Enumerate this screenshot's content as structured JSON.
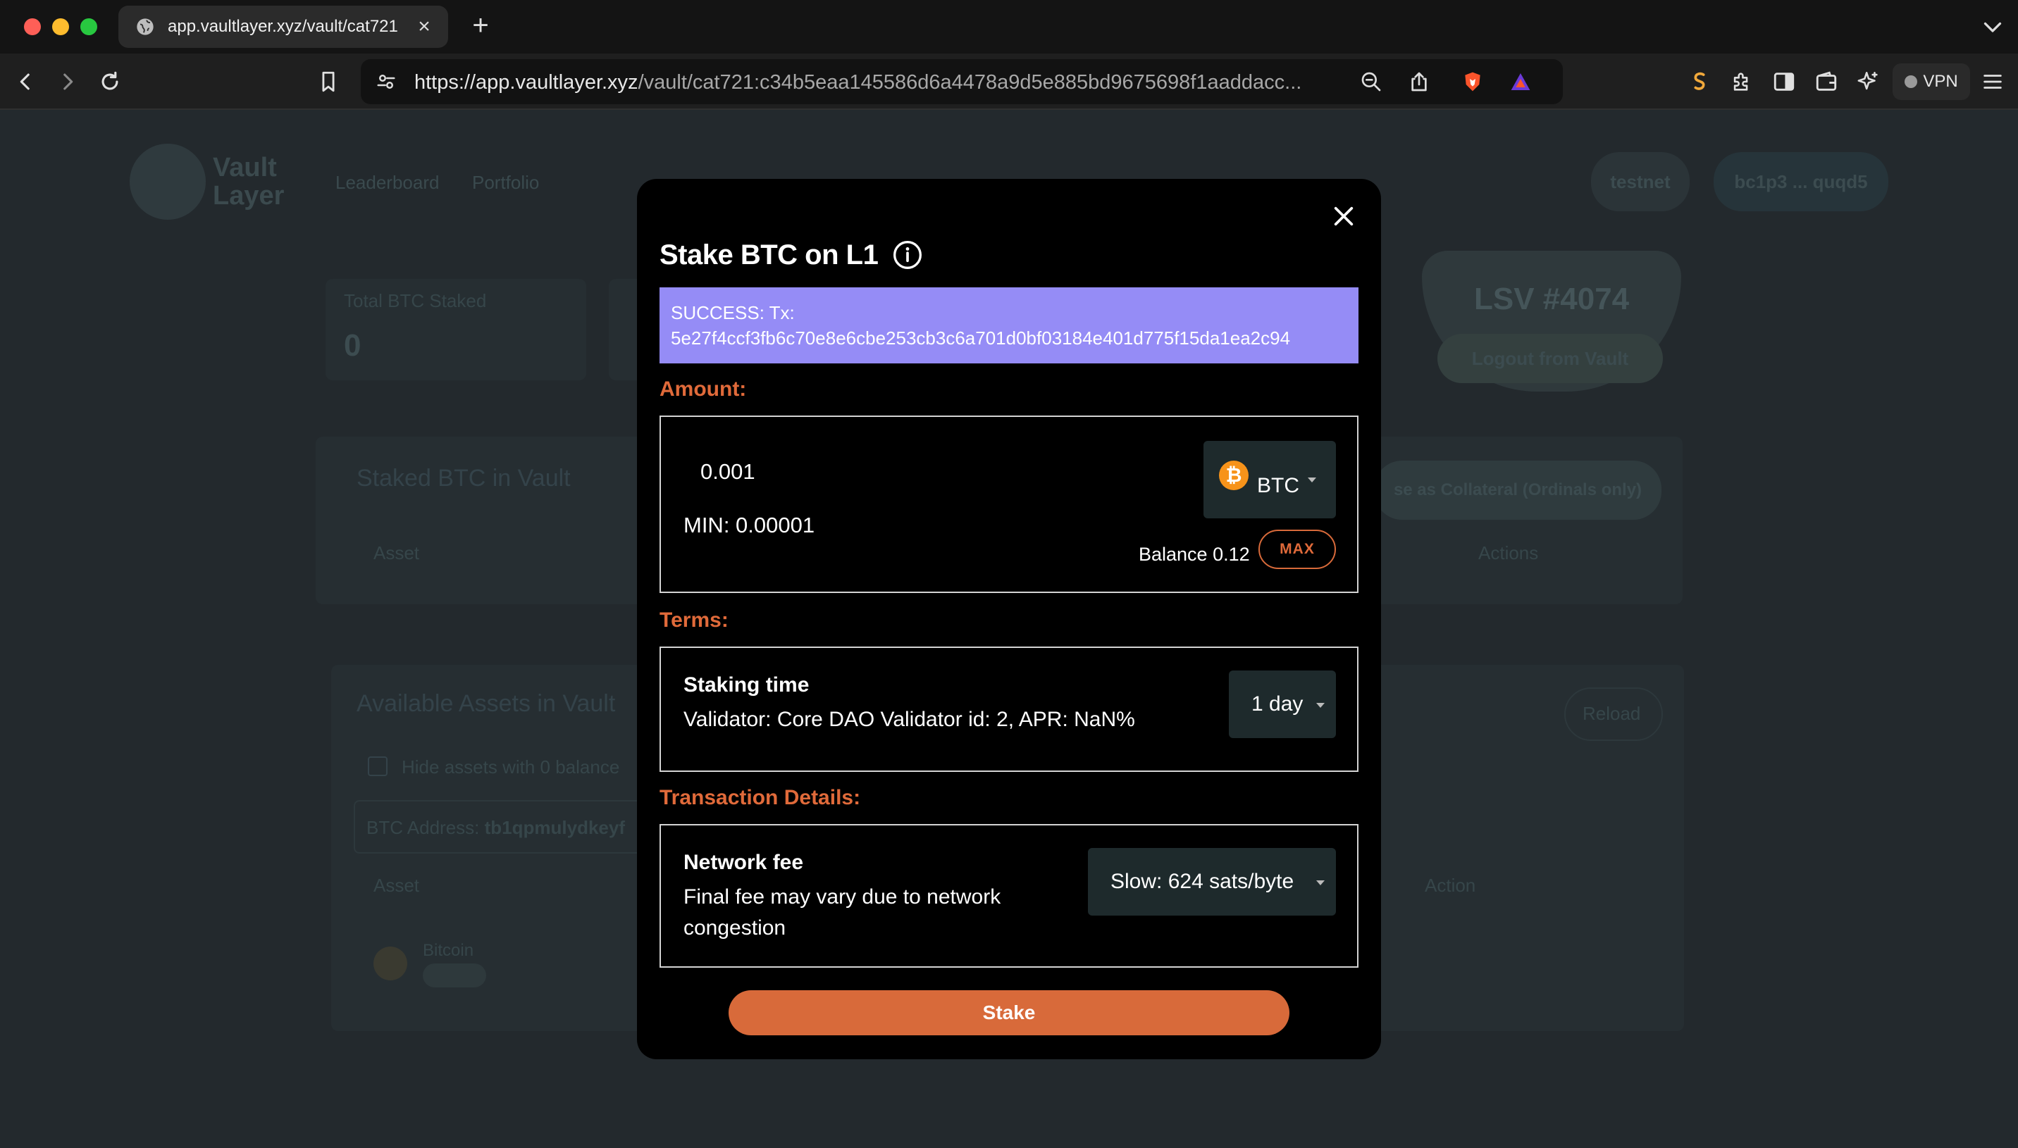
{
  "browser": {
    "tab_title": "app.vaultlayer.xyz/vault/cat721",
    "url_host": "https://app.vaultlayer.xyz",
    "url_path": "/vault/cat721:c34b5eaa145586d6a4478a9d5e885bd9675698f1aaddacc...",
    "vpn_label": "VPN"
  },
  "background": {
    "logo_line1": "Vault",
    "logo_line2": "Layer",
    "nav": [
      "Leaderboard",
      "Portfolio"
    ],
    "network_label": "testnet",
    "wallet_label": "bc1p3 ... quqd5",
    "total_staked_label": "Total BTC Staked",
    "total_staked_value": "0",
    "lsv_label": "LSV #4074",
    "logout_label": "Logout from Vault",
    "staked_section_title": "Staked BTC in Vault",
    "collateral_label": "se as Collateral (Ordinals only)",
    "asset_col": "Asset",
    "actions_col": "Actions",
    "available_title": "Available Assets in Vault",
    "reload_label": "Reload",
    "hide_zero_label": "Hide assets with 0 balance",
    "btc_address_label": "BTC Address:",
    "btc_address_value": "tb1qpmulydkeyf",
    "asset_col2": "Asset",
    "action_col": "Action",
    "bitcoin_label": "Bitcoin"
  },
  "modal": {
    "title": "Stake BTC on L1",
    "success_line1": "SUCCESS: Tx:",
    "success_line2": "5e27f4ccf3fb6c70e8e6cbe253cb3c6a701d0bf03184e401d775f15da1ea2c94",
    "amount_label": "Amount:",
    "amount_value": "0.001",
    "min_text": "MIN: 0.00001",
    "token_symbol": "BTC",
    "balance_text": "Balance 0.12",
    "max_label": "MAX",
    "terms_label": "Terms:",
    "staking_time_title": "Staking time",
    "validator_text": "Validator: Core DAO Validator id: 2, APR: NaN%",
    "staking_time_value": "1 day",
    "tx_details_label": "Transaction Details:",
    "network_fee_title": "Network fee",
    "network_fee_note_line1": "Final fee may vary due to network",
    "network_fee_note_line2": "congestion",
    "fee_option": "Slow: 624 sats/byte",
    "stake_label": "Stake"
  },
  "colors": {
    "accent": "#d86a3a",
    "success_bg": "#958cf6",
    "btc": "#f7931a"
  }
}
